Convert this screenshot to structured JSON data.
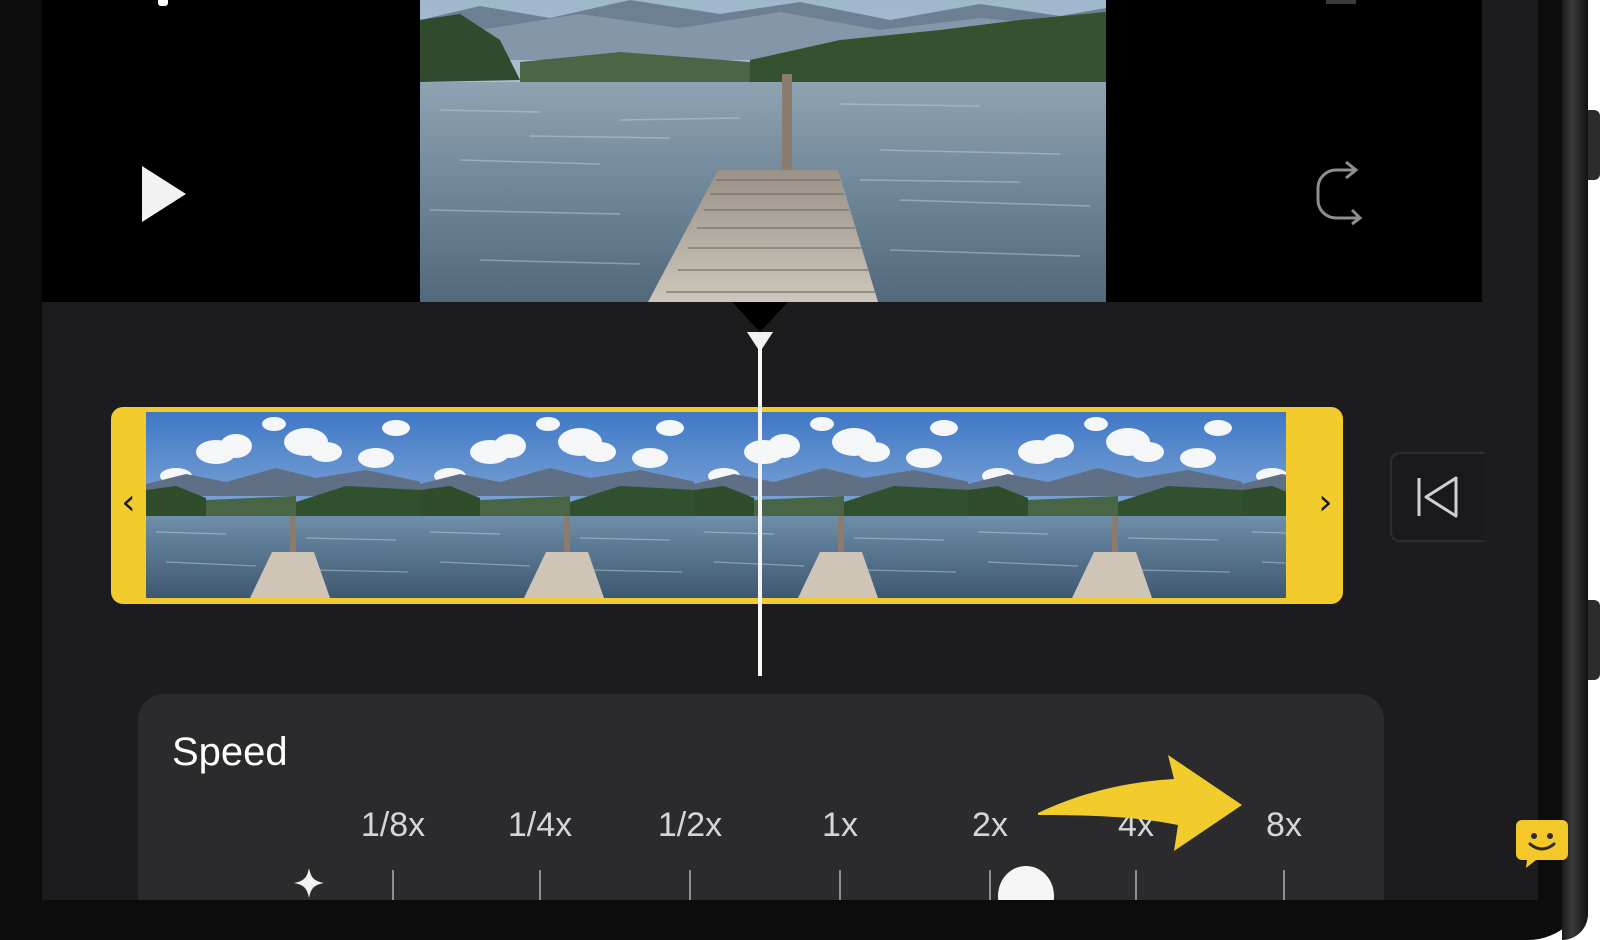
{
  "colors": {
    "accent_yellow": "#F2CC2D",
    "screen_background": "#1C1C1E",
    "panel_background": "#2B2B2D",
    "viewer_background": "#000000",
    "text_white": "#FFFFFF",
    "text_secondary": "#D6D6D8"
  },
  "icons": {
    "play": "play-icon",
    "rotate": "rotate-icon",
    "skip_to_start": "skip-to-start-icon",
    "trim_left": "chevron-left-icon",
    "trim_right": "chevron-right-icon",
    "sparkle": "sparkle-icon",
    "arrow": "arrow-right-icon",
    "chat": "chat-smile-icon"
  },
  "clip": {
    "trim_left_glyph": "‹",
    "trim_right_glyph": "›"
  },
  "speed": {
    "title": "Speed",
    "options": [
      "1/8x",
      "1/4x",
      "1/2x",
      "1x",
      "2x",
      "4x",
      "8x"
    ],
    "selected": "2x"
  }
}
